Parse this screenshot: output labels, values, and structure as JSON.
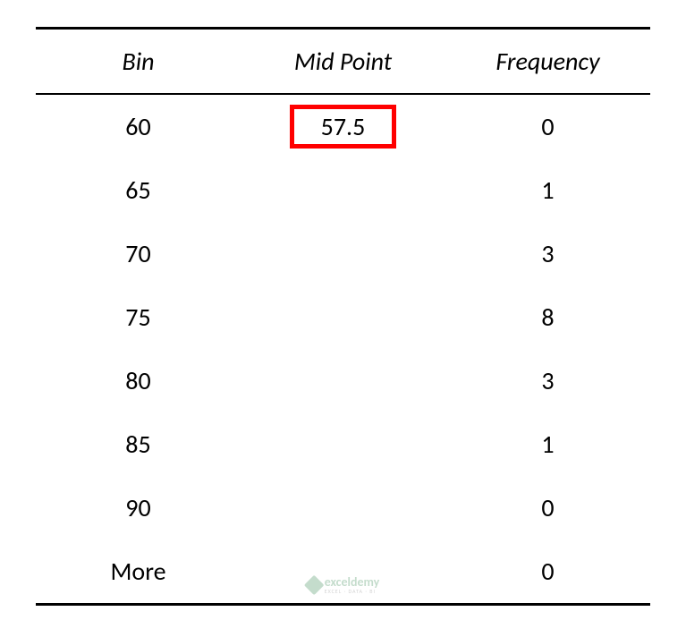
{
  "chart_data": {
    "type": "table",
    "title": "",
    "columns": [
      "Bin",
      "Mid Point",
      "Frequency"
    ],
    "rows": [
      {
        "bin": "60",
        "midpoint": "57.5",
        "frequency": "0",
        "highlight_midpoint": true
      },
      {
        "bin": "65",
        "midpoint": "",
        "frequency": "1",
        "highlight_midpoint": false
      },
      {
        "bin": "70",
        "midpoint": "",
        "frequency": "3",
        "highlight_midpoint": false
      },
      {
        "bin": "75",
        "midpoint": "",
        "frequency": "8",
        "highlight_midpoint": false
      },
      {
        "bin": "80",
        "midpoint": "",
        "frequency": "3",
        "highlight_midpoint": false
      },
      {
        "bin": "85",
        "midpoint": "",
        "frequency": "1",
        "highlight_midpoint": false
      },
      {
        "bin": "90",
        "midpoint": "",
        "frequency": "0",
        "highlight_midpoint": false
      },
      {
        "bin": "More",
        "midpoint": "",
        "frequency": "0",
        "highlight_midpoint": false
      }
    ]
  },
  "watermark": {
    "main": "exceldemy",
    "sub": "EXCEL · DATA · BI"
  }
}
